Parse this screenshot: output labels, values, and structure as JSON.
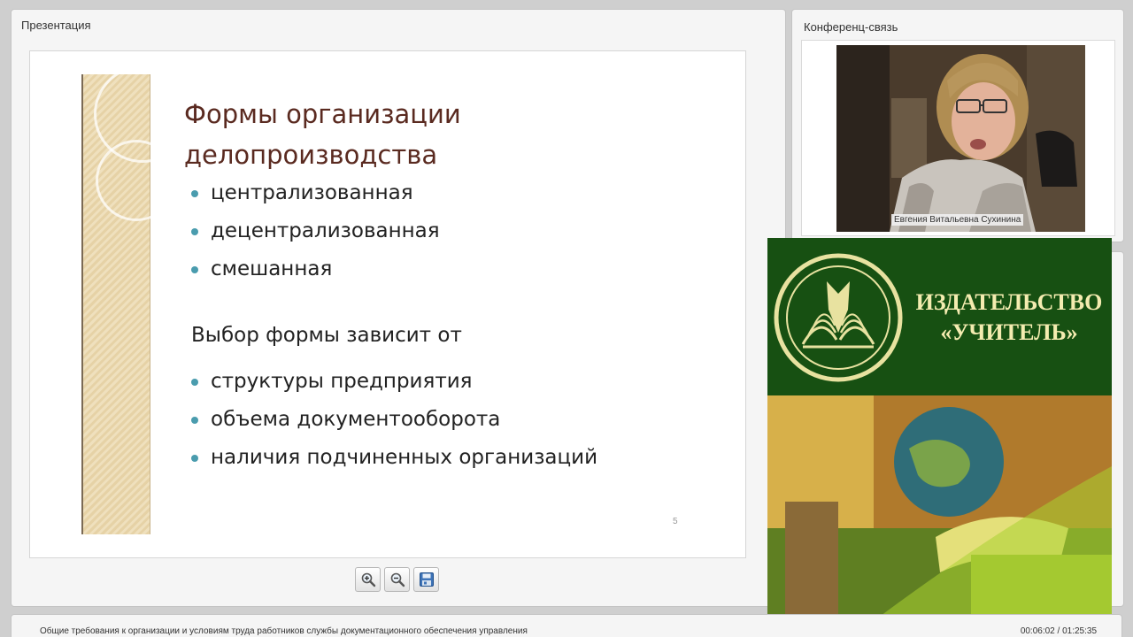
{
  "presentation": {
    "panel_title": "Презентация",
    "slide": {
      "title": "Формы организации делопроизводства",
      "forms": [
        "централизованная",
        "децентрализованная",
        "смешанная"
      ],
      "choice_heading": "Выбор формы зависит от",
      "factors": [
        "структуры предприятия",
        "объема документооборота",
        "наличия подчиненных организаций"
      ],
      "page_number": "5"
    },
    "toolbar": [
      {
        "name": "zoom-in-button",
        "icon": "zoom-in-icon"
      },
      {
        "name": "zoom-out-button",
        "icon": "zoom-out-icon"
      },
      {
        "name": "save-button",
        "icon": "save-icon"
      }
    ]
  },
  "conference": {
    "panel_title": "Конференц-связь",
    "speaker_name": "Евгения Витальевна Сухинина"
  },
  "ad": {
    "publisher_name": "ИЗДАТЕЛЬСТВО «УЧИТЕЛЬ»",
    "colors": {
      "top": "#175012",
      "text": "#f4ecb0",
      "accent": "#a5c931"
    }
  },
  "footer": {
    "lecture_title": "Общие требования к организации и условиям труда работников службы документационного обеспечения управления",
    "time": "00:06:02 / 01:25:35"
  }
}
